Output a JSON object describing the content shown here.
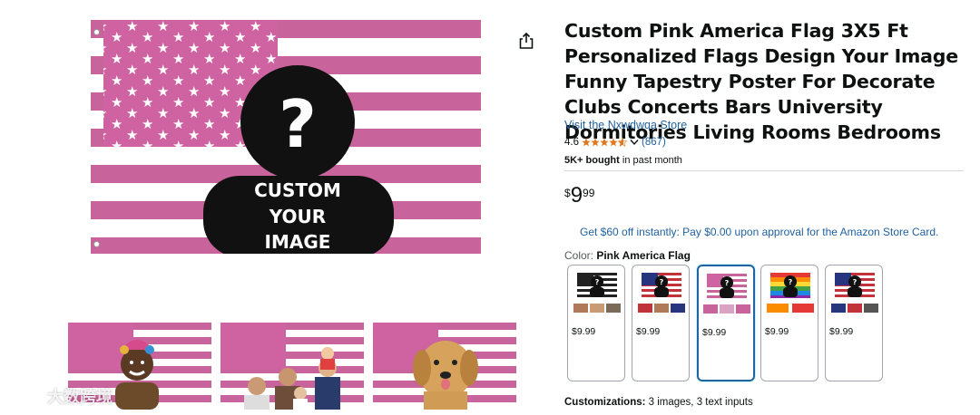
{
  "product": {
    "title": "Custom Pink America Flag 3X5 Ft Personalized Flags Design Your Image Funny Tapestry Poster For Decorate Clubs Concerts Bars University Dormitories Living Rooms Bedrooms",
    "store_link": "Visit the Nxwdwqa Store",
    "rating_value": "4.6",
    "rating_stars": 4.6,
    "rating_count": "(867)",
    "bought_bold": "5K+ bought",
    "bought_rest": " in past month",
    "price_currency": "$",
    "price_whole": "9",
    "price_fraction": "99",
    "promo_text": "Get $60 off instantly: Pay $0.00 upon approval for the Amazon Store Card.",
    "color_label": "Color: ",
    "color_value": "Pink America Flag",
    "customizations_label": "Customizations:",
    "customizations_value": " 3 images, 3 text inputs"
  },
  "main_image": {
    "overlay_lines": [
      "CUSTOM",
      "YOUR",
      "IMAGE"
    ],
    "question_mark": "?"
  },
  "swatches": [
    {
      "variant": "black-white-flag",
      "price": "$9.99",
      "selected": false
    },
    {
      "variant": "usa-flag",
      "price": "$9.99",
      "selected": false
    },
    {
      "variant": "pink-flag",
      "price": "$9.99",
      "selected": true
    },
    {
      "variant": "rainbow-flag",
      "price": "$9.99",
      "selected": false
    },
    {
      "variant": "usa-flag-2",
      "price": "$9.99",
      "selected": false
    }
  ],
  "watermark": "大数跨境",
  "colors": {
    "pink_stripe": "#c9639b",
    "pink_canton": "#cf62a0",
    "link": "#2162a1",
    "star_orange": "#de7921",
    "selected_border": "#2162a1"
  }
}
